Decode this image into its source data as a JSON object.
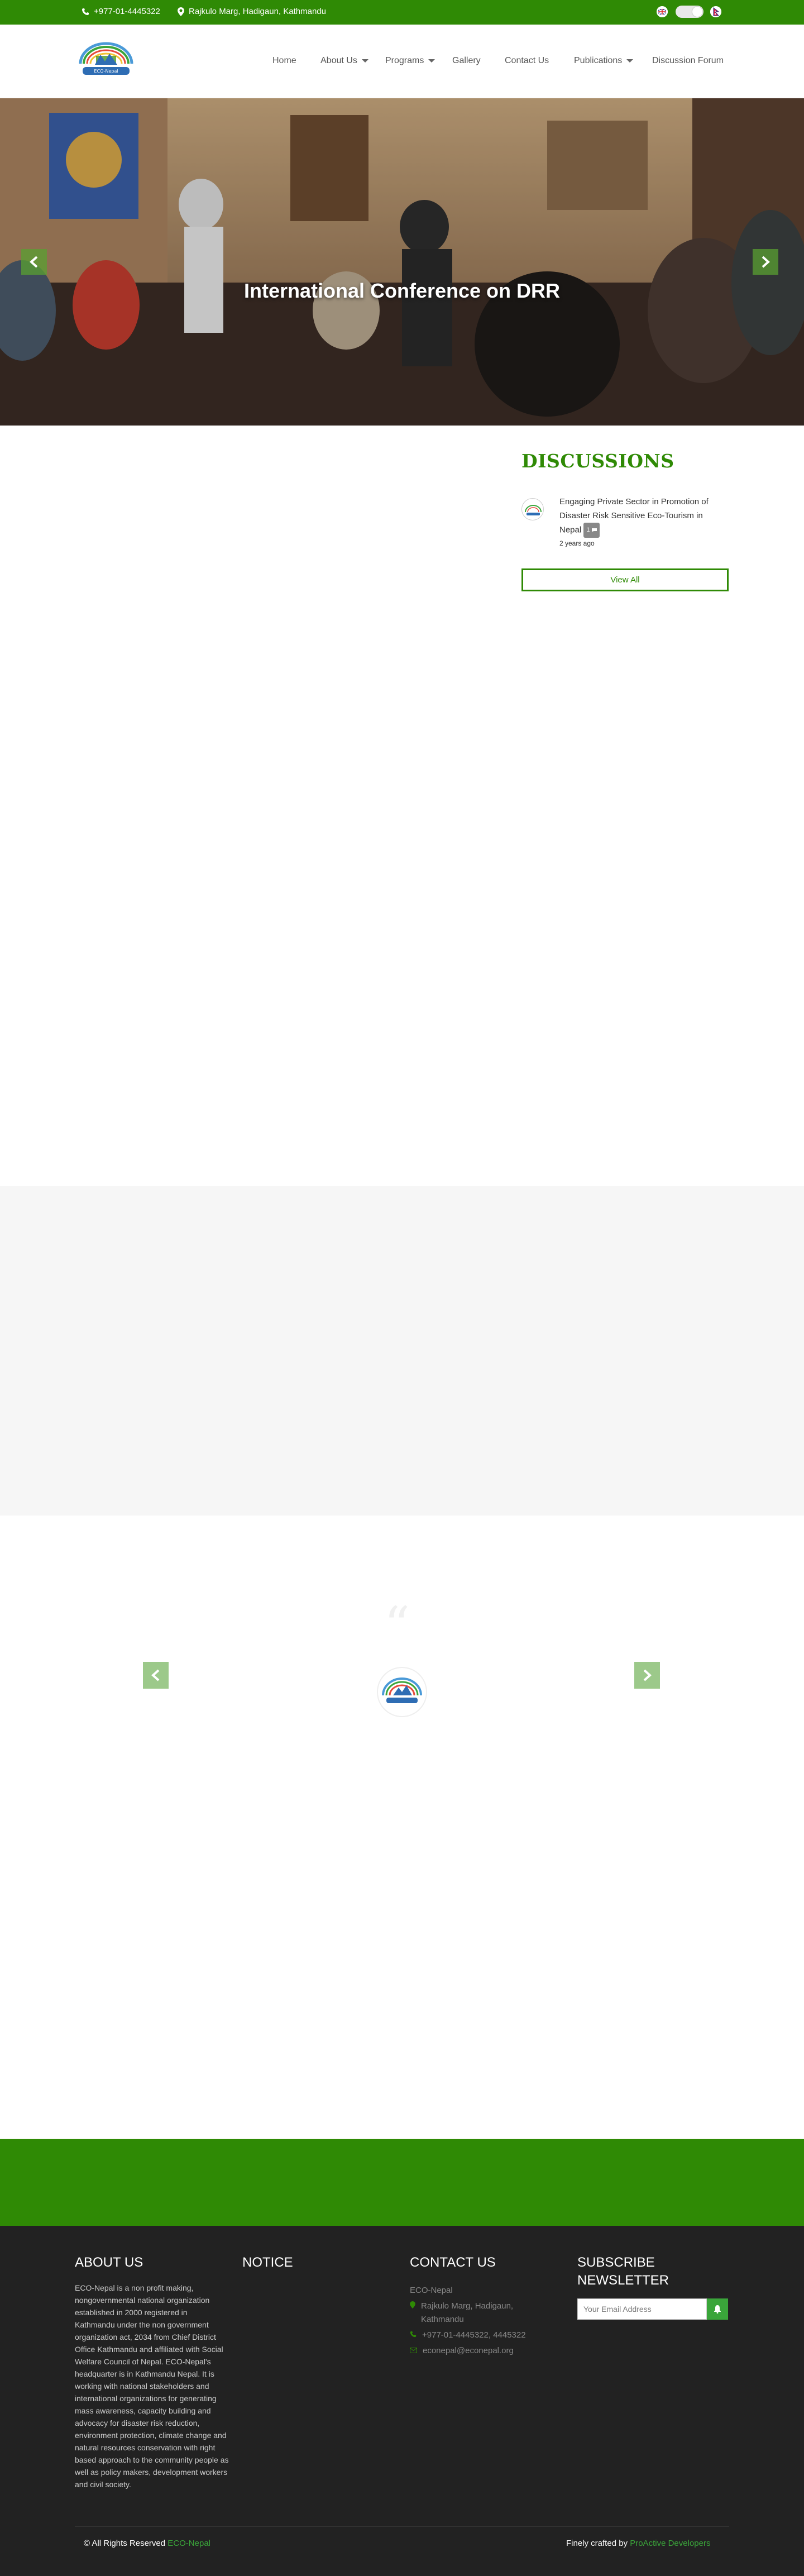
{
  "topbar": {
    "phone": "+977-01-4445322",
    "address": "Rajkulo Marg, Hadigaun, Kathmandu"
  },
  "nav": {
    "items": [
      {
        "label": "Home",
        "has_dropdown": false
      },
      {
        "label": "About Us",
        "has_dropdown": true
      },
      {
        "label": "Programs",
        "has_dropdown": true
      },
      {
        "label": "Gallery",
        "has_dropdown": false
      },
      {
        "label": "Contact Us",
        "has_dropdown": false
      },
      {
        "label": "Publications",
        "has_dropdown": true
      },
      {
        "label": "Discussion Forum",
        "has_dropdown": false
      }
    ]
  },
  "hero": {
    "title": "International Conference on DRR"
  },
  "discussions": {
    "heading": "DISCUSSIONS",
    "items": [
      {
        "title": "Engaging Private Sector in Promotion of Disaster Risk Sensitive Eco-Tourism in Nepal",
        "count": "1",
        "time": "2 years ago"
      }
    ],
    "view_all": "View All"
  },
  "testimonial": {
    "quote_mark": "“"
  },
  "footer": {
    "about": {
      "heading": "ABOUT US",
      "text": "ECO-Nepal is a non profit making, nongovernmental national organization established in 2000 registered in Kathmandu under the non government organization act, 2034 from Chief District Office Kathmandu and affiliated with Social Welfare Council of Nepal. ECO-Nepal's headquarter is in Kathmandu Nepal. It is working with national stakeholders and international organizations for generating mass awareness, capacity building and advocacy for disaster risk reduction, environment protection, climate change and natural resources conservation with right based approach to the community people as well as policy makers, development workers and civil society."
    },
    "notice": {
      "heading": "NOTICE"
    },
    "contact": {
      "heading": "CONTACT US",
      "org": "ECO-Nepal",
      "address": "Rajkulo Marg, Hadigaun, Kathmandu",
      "phone": "+977-01-4445322, 4445322",
      "email": "econepal@econepal.org"
    },
    "newsletter": {
      "heading": "SUBSCRIBE NEWSLETTER",
      "placeholder": "Your Email Address"
    },
    "copyright_prefix": "© All Rights Reserved",
    "copyright_org": "ECO-Nepal",
    "credits_prefix": "Finely crafted by",
    "credits_company": "ProActive Developers"
  },
  "colors": {
    "brand_green": "#2f8a05",
    "footer_bg": "#222222",
    "accent_green": "#3aa53a"
  }
}
